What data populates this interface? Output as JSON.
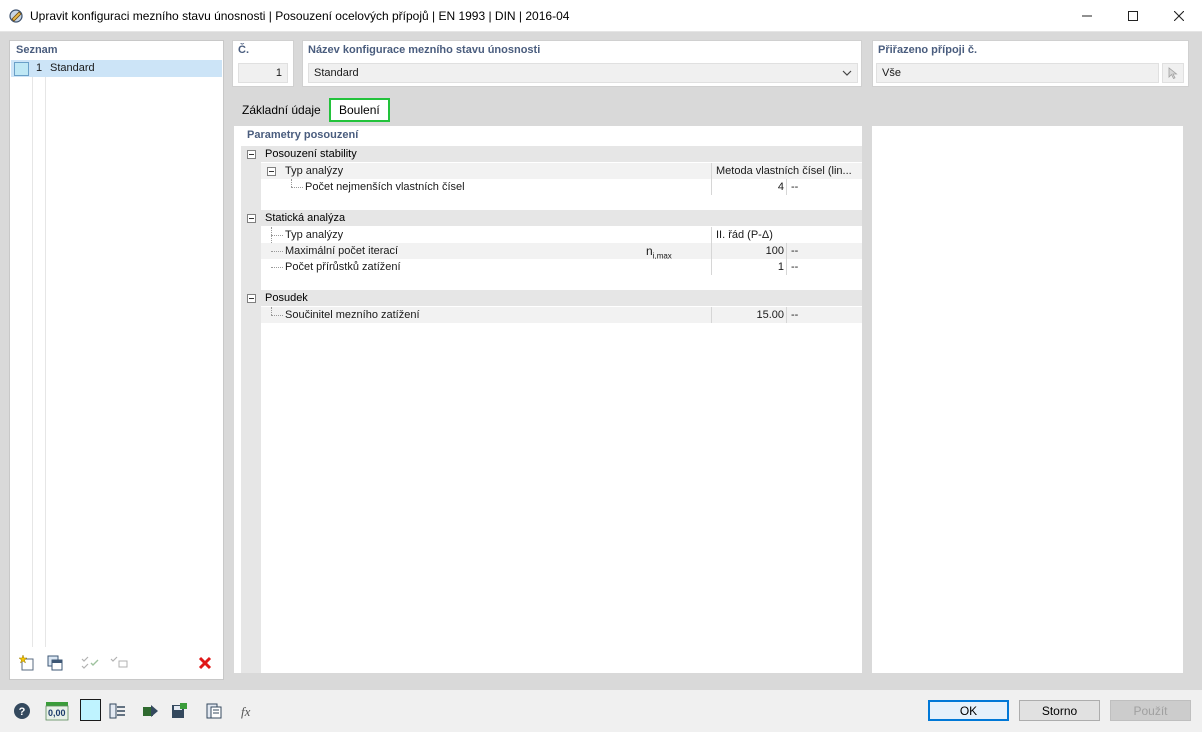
{
  "window": {
    "title": "Upravit konfiguraci mezního stavu únosnosti | Posouzení ocelových přípojů | EN 1993 | DIN | 2016-04"
  },
  "list": {
    "label": "Seznam",
    "items": [
      {
        "number": "1",
        "name": "Standard"
      }
    ]
  },
  "header": {
    "number_label": "Č.",
    "number_value": "1",
    "name_label": "Název konfigurace mezního stavu únosnosti",
    "name_value": "Standard",
    "assigned_label": "Přiřazeno přípoji č.",
    "assigned_value": "Vše"
  },
  "tabs": [
    {
      "label": "Základní údaje",
      "active": false
    },
    {
      "label": "Boulení",
      "active": true
    }
  ],
  "params": {
    "title": "Parametry posouzení",
    "groups": [
      {
        "label": "Posouzení stability",
        "rows": [
          {
            "label": "Typ analýzy",
            "symbol": "",
            "value": "Metoda vlastních čísel (lin...",
            "unit": ""
          },
          {
            "label": "Počet nejmenších vlastních čísel",
            "symbol": "",
            "value": "4",
            "unit": "--"
          }
        ]
      },
      {
        "label": "Statická analýza",
        "rows": [
          {
            "label": "Typ analýzy",
            "symbol": "",
            "value": "II. řád (P-Δ)",
            "unit": ""
          },
          {
            "label": "Maximální počet iterací",
            "symbol_main": "n",
            "symbol_sub": "i,max",
            "value": "100",
            "unit": "--"
          },
          {
            "label": "Počet přírůstků zatížení",
            "symbol": "",
            "value": "1",
            "unit": "--"
          }
        ]
      },
      {
        "label": "Posudek",
        "rows": [
          {
            "label": "Součinitel mezního zatížení",
            "symbol": "",
            "value": "15.00",
            "unit": "--"
          }
        ]
      }
    ]
  },
  "buttons": {
    "ok": "OK",
    "cancel": "Storno",
    "apply": "Použít"
  },
  "bottom_toolbar": {
    "units_label": "0,00"
  },
  "colors": {
    "accent_tab_border": "#22c23b",
    "selection": "#cce4f7",
    "label_blue": "#4a5d7e",
    "primary_border": "#0078d7"
  }
}
